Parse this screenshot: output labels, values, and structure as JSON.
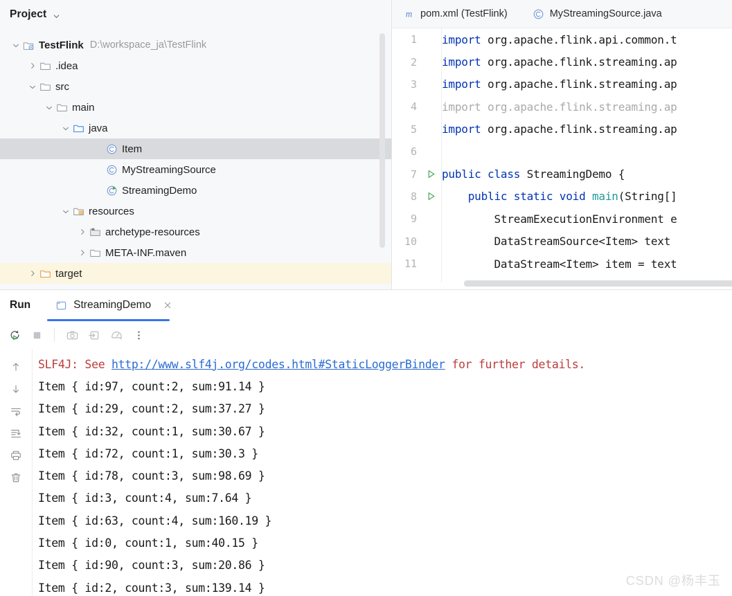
{
  "project": {
    "title": "Project",
    "tree": [
      {
        "label": "TestFlink",
        "path": "D:\\workspace_ja\\TestFlink",
        "indent": 0,
        "twisty": "down",
        "icon": "module-icon",
        "bold": true,
        "state": "normal"
      },
      {
        "label": ".idea",
        "path": "",
        "indent": 1,
        "twisty": "right",
        "icon": "folder-icon",
        "bold": false,
        "state": "normal"
      },
      {
        "label": "src",
        "path": "",
        "indent": 1,
        "twisty": "down",
        "icon": "folder-icon",
        "bold": false,
        "state": "normal"
      },
      {
        "label": "main",
        "path": "",
        "indent": 2,
        "twisty": "down",
        "icon": "folder-icon",
        "bold": false,
        "state": "normal"
      },
      {
        "label": "java",
        "path": "",
        "indent": 3,
        "twisty": "down",
        "icon": "source-root-icon",
        "bold": false,
        "state": "normal"
      },
      {
        "label": "Item",
        "path": "",
        "indent": 5,
        "twisty": "none",
        "icon": "java-class-icon",
        "bold": false,
        "state": "selected"
      },
      {
        "label": "MyStreamingSource",
        "path": "",
        "indent": 5,
        "twisty": "none",
        "icon": "java-class-icon",
        "bold": false,
        "state": "normal"
      },
      {
        "label": "StreamingDemo",
        "path": "",
        "indent": 5,
        "twisty": "none",
        "icon": "java-runnable-class-icon",
        "bold": false,
        "state": "normal"
      },
      {
        "label": "resources",
        "path": "",
        "indent": 3,
        "twisty": "down",
        "icon": "resource-root-icon",
        "bold": false,
        "state": "normal"
      },
      {
        "label": "archetype-resources",
        "path": "",
        "indent": 4,
        "twisty": "right",
        "icon": "excluded-folder-icon",
        "bold": false,
        "state": "normal"
      },
      {
        "label": "META-INF.maven",
        "path": "",
        "indent": 4,
        "twisty": "right",
        "icon": "folder-icon",
        "bold": false,
        "state": "normal"
      },
      {
        "label": "target",
        "path": "",
        "indent": 1,
        "twisty": "right",
        "icon": "excluded-target-folder-icon",
        "bold": false,
        "state": "excluded"
      }
    ]
  },
  "editor": {
    "tabs": [
      {
        "label": "pom.xml (TestFlink)",
        "icon": "maven-icon",
        "active": false
      },
      {
        "label": "MyStreamingSource.java",
        "icon": "java-class-icon",
        "active": false
      }
    ],
    "lines": [
      {
        "num": "1",
        "gutter": "",
        "dim": false,
        "parts": [
          {
            "t": "import ",
            "c": "k"
          },
          {
            "t": "org.apache.flink.api.common.t",
            "c": "ident"
          }
        ]
      },
      {
        "num": "2",
        "gutter": "",
        "dim": false,
        "parts": [
          {
            "t": "import ",
            "c": "k"
          },
          {
            "t": "org.apache.flink.streaming.ap",
            "c": "ident"
          }
        ]
      },
      {
        "num": "3",
        "gutter": "",
        "dim": false,
        "parts": [
          {
            "t": "import ",
            "c": "k"
          },
          {
            "t": "org.apache.flink.streaming.ap",
            "c": "ident"
          }
        ]
      },
      {
        "num": "4",
        "gutter": "",
        "dim": true,
        "parts": [
          {
            "t": "import ",
            "c": "dim"
          },
          {
            "t": "org.apache.flink.streaming.ap",
            "c": "dim"
          }
        ]
      },
      {
        "num": "5",
        "gutter": "",
        "dim": false,
        "parts": [
          {
            "t": "import ",
            "c": "k"
          },
          {
            "t": "org.apache.flink.streaming.ap",
            "c": "ident"
          }
        ]
      },
      {
        "num": "6",
        "gutter": "",
        "dim": false,
        "parts": [
          {
            "t": "",
            "c": "ident"
          }
        ]
      },
      {
        "num": "7",
        "gutter": "run-arrow",
        "dim": false,
        "parts": [
          {
            "t": "public class ",
            "c": "k"
          },
          {
            "t": "StreamingDemo {",
            "c": "ident"
          }
        ]
      },
      {
        "num": "8",
        "gutter": "run-arrow",
        "dim": false,
        "parts": [
          {
            "t": "    public static void ",
            "c": "k"
          },
          {
            "t": "main",
            "c": "tY"
          },
          {
            "t": "(String[]",
            "c": "ident"
          }
        ]
      },
      {
        "num": "9",
        "gutter": "",
        "dim": false,
        "parts": [
          {
            "t": "        StreamExecutionEnvironment e",
            "c": "ident"
          }
        ]
      },
      {
        "num": "10",
        "gutter": "",
        "dim": false,
        "parts": [
          {
            "t": "        DataStreamSource<Item> text",
            "c": "ident"
          }
        ]
      },
      {
        "num": "11",
        "gutter": "",
        "dim": false,
        "parts": [
          {
            "t": "        DataStream<Item> item = text",
            "c": "ident"
          }
        ]
      }
    ]
  },
  "run": {
    "title": "Run",
    "tab_label": "StreamingDemo",
    "toolbar": [
      {
        "name": "rerun-button",
        "icon": "rerun-icon"
      },
      {
        "name": "stop-button",
        "icon": "stop-icon"
      },
      {
        "name": "screenshot-button",
        "icon": "camera-icon"
      },
      {
        "name": "export-button",
        "icon": "export-icon"
      },
      {
        "name": "profiler-button",
        "icon": "gauge-icon"
      },
      {
        "name": "more-options-button",
        "icon": "more-vertical-icon"
      }
    ],
    "side_toolbar": [
      {
        "name": "up-button",
        "icon": "arrow-up-icon"
      },
      {
        "name": "down-button",
        "icon": "arrow-down-icon"
      },
      {
        "name": "soft-wrap-button",
        "icon": "soft-wrap-icon"
      },
      {
        "name": "scroll-to-end-button",
        "icon": "scroll-end-icon"
      },
      {
        "name": "print-button",
        "icon": "printer-icon"
      },
      {
        "name": "clear-button",
        "icon": "trash-icon"
      }
    ],
    "console": [
      {
        "type": "error-link",
        "pre": "SLF4J: See ",
        "link": "http://www.slf4j.org/codes.html#StaticLoggerBinder",
        "post": " for further details."
      },
      {
        "type": "plain",
        "text": "Item { id:97, count:2, sum:91.14 }"
      },
      {
        "type": "plain",
        "text": "Item { id:29, count:2, sum:37.27 }"
      },
      {
        "type": "plain",
        "text": "Item { id:32, count:1, sum:30.67 }"
      },
      {
        "type": "plain",
        "text": "Item { id:72, count:1, sum:30.3 }"
      },
      {
        "type": "plain",
        "text": "Item { id:78, count:3, sum:98.69 }"
      },
      {
        "type": "plain",
        "text": "Item { id:3, count:4, sum:7.64 }"
      },
      {
        "type": "plain",
        "text": "Item { id:63, count:4, sum:160.19 }"
      },
      {
        "type": "plain",
        "text": "Item { id:0, count:1, sum:40.15 }"
      },
      {
        "type": "plain",
        "text": "Item { id:90, count:3, sum:20.86 }"
      },
      {
        "type": "plain",
        "text": "Item { id:2, count:3, sum:139.14 }"
      }
    ]
  },
  "watermark": "CSDN @杨丰玉",
  "colors": {
    "accent": "#3574f0",
    "keyword": "#0033b3",
    "error": "#bd3c3c",
    "link": "#2b6cd4",
    "excluded_bg": "#fcf5e0",
    "selection_bg": "#d9dadd"
  }
}
